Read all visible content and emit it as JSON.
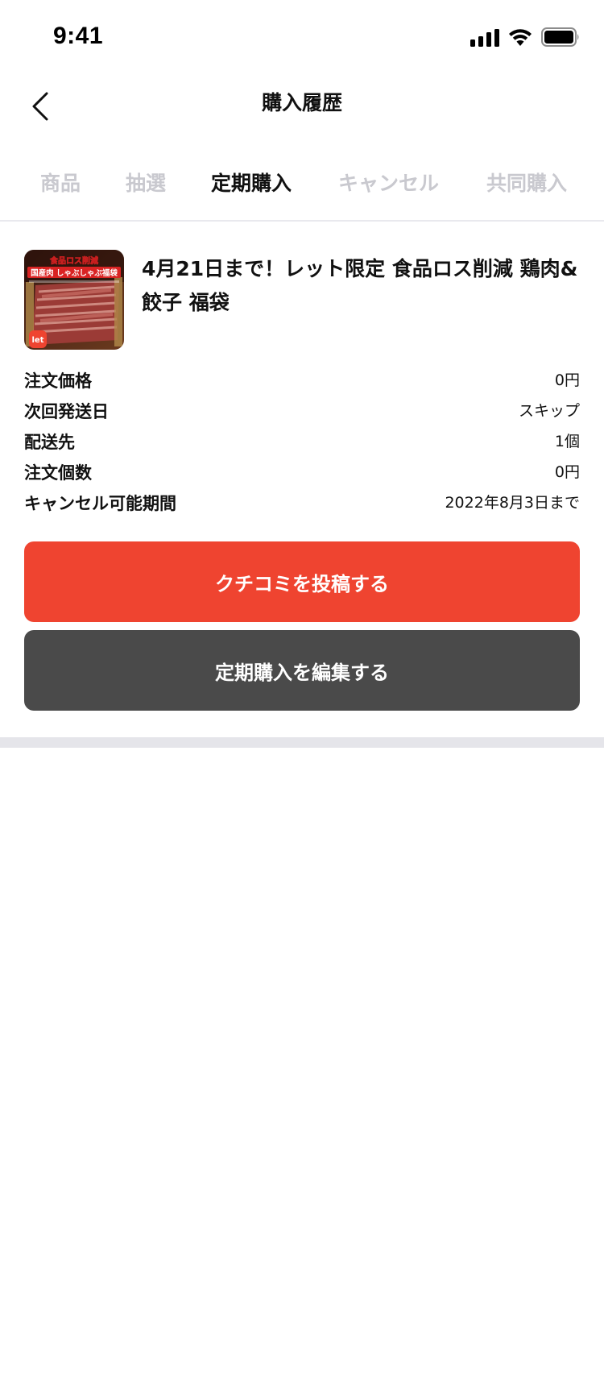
{
  "status_bar": {
    "time": "9:41"
  },
  "header": {
    "title": "購入履歴"
  },
  "tabs": [
    {
      "label": "商品",
      "active": false
    },
    {
      "label": "抽選",
      "active": false
    },
    {
      "label": "定期購入",
      "active": true
    },
    {
      "label": "キャンセル",
      "active": false
    },
    {
      "label": "共同購入",
      "active": false
    }
  ],
  "order": {
    "title": "4月21日まで！レット限定 食品ロス削減 鶏肉&餃子 福袋",
    "thumbnail": {
      "banner_top": "食品ロス削減",
      "banner_main": "国産肉 しゃぶしゃぶ福袋",
      "brand_badge": "let"
    },
    "details": [
      {
        "label": "注文価格",
        "value": "0円"
      },
      {
        "label": "次回発送日",
        "value": "スキップ"
      },
      {
        "label": "配送先",
        "value": "1個"
      },
      {
        "label": "注文個数",
        "value": "0円"
      },
      {
        "label": "キャンセル可能期間",
        "value": "2022年8月3日まで"
      }
    ],
    "review_button": "クチコミを投稿する",
    "edit_button": "定期購入を編集する"
  },
  "colors": {
    "accent": "#ef4430",
    "secondary_button": "#4a4a4a",
    "inactive_tab": "#c9c9cf",
    "divider": "#e5e5ea"
  }
}
